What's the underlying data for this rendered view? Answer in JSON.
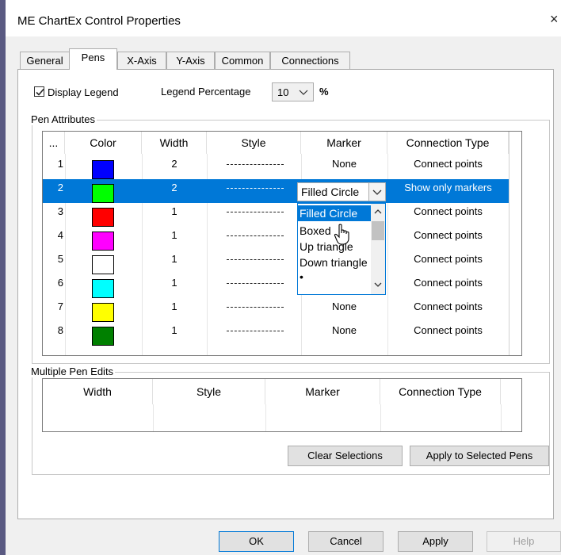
{
  "window": {
    "title": "ME ChartEx Control Properties",
    "close_glyph": "×"
  },
  "tabs": [
    {
      "label": "General"
    },
    {
      "label": "Pens"
    },
    {
      "label": "X-Axis"
    },
    {
      "label": "Y-Axis"
    },
    {
      "label": "Common"
    },
    {
      "label": "Connections"
    }
  ],
  "legend": {
    "display_label": "Display Legend",
    "display_checked": true,
    "percentage_label": "Legend Percentage",
    "percentage_value": "10",
    "percent_sign": "%"
  },
  "pen_attributes": {
    "group_title": "Pen Attributes",
    "headers": [
      "...",
      "Color",
      "Width",
      "Style",
      "Marker",
      "Connection Type"
    ],
    "rows": [
      {
        "num": "1",
        "color": "#0000ff",
        "width": "2",
        "marker": "None",
        "connection": "Connect points"
      },
      {
        "num": "2",
        "color": "#00ff00",
        "width": "2",
        "marker": "Filled Circle",
        "connection": "Show only markers",
        "selected": true
      },
      {
        "num": "3",
        "color": "#ff0000",
        "width": "1",
        "marker": "",
        "connection": "Connect points"
      },
      {
        "num": "4",
        "color": "#ff00ff",
        "width": "1",
        "marker": "",
        "connection": "Connect points"
      },
      {
        "num": "5",
        "color": "#ffffff",
        "width": "1",
        "marker": "",
        "connection": "Connect points"
      },
      {
        "num": "6",
        "color": "#00ffff",
        "width": "1",
        "marker": "",
        "connection": "Connect points"
      },
      {
        "num": "7",
        "color": "#ffff00",
        "width": "1",
        "marker": "None",
        "connection": "Connect points"
      },
      {
        "num": "8",
        "color": "#008000",
        "width": "1",
        "marker": "None",
        "connection": "Connect points"
      }
    ],
    "marker_dropdown": {
      "selected": "Filled Circle",
      "options": [
        "Filled Circle",
        "Boxed",
        "Up triangle",
        "Down triangle",
        "•"
      ]
    }
  },
  "multiple_pen_edits": {
    "group_title": "Multiple Pen Edits",
    "headers": [
      "Width",
      "Style",
      "Marker",
      "Connection Type"
    ]
  },
  "buttons": {
    "clear_selections": "Clear Selections",
    "apply_selected": "Apply to Selected Pens",
    "ok": "OK",
    "cancel": "Cancel",
    "apply": "Apply",
    "help": "Help"
  },
  "colors": {
    "accent": "#0078d7",
    "frame": "#5a5a82"
  }
}
